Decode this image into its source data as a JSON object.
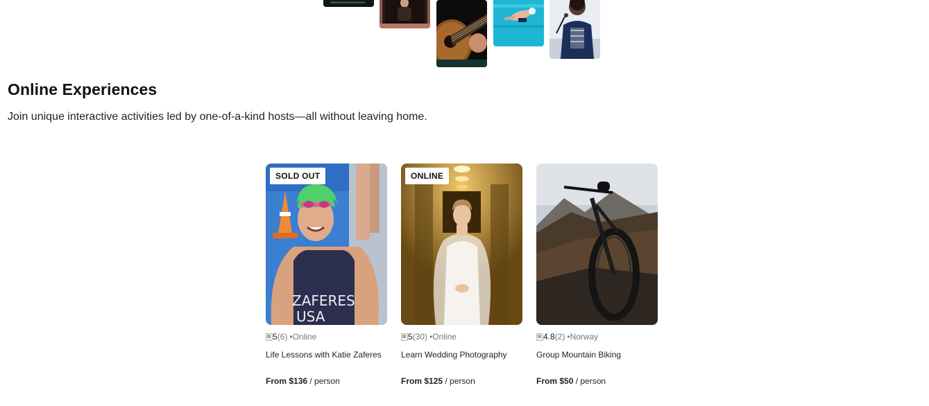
{
  "top_strip": [
    {
      "subject": "dark-landscape"
    },
    {
      "subject": "person-on-stairs"
    },
    {
      "subject": "acoustic-guitar"
    },
    {
      "subject": "swimmer-in-pool"
    },
    {
      "subject": "singer-with-microphone"
    }
  ],
  "section": {
    "title": "Online Experiences",
    "subtitle": "Join unique interactive activities led by one-of-a-kind hosts—all without leaving home."
  },
  "cards": [
    {
      "badge": "SOLD OUT",
      "rating": "5",
      "reviews": "(6)",
      "separator": "•",
      "location": "Online",
      "title": "Life Lessons with Katie Zaferes",
      "price_prefix": "From ",
      "price": "$136",
      "price_suffix": " / person",
      "photo_text_1": "ZAFERES",
      "photo_text_2": "USA"
    },
    {
      "badge": "ONLINE",
      "rating": "5",
      "reviews": "(30)",
      "separator": "•",
      "location": "Online",
      "title": "Learn Wedding Photography",
      "price_prefix": "From ",
      "price": "$125",
      "price_suffix": " / person"
    },
    {
      "badge": "",
      "rating": "4.8",
      "reviews": "(2)",
      "separator": "•",
      "location": "Norway",
      "title": "Group Mountain Biking",
      "price_prefix": "From ",
      "price": "$50",
      "price_suffix": " / person"
    }
  ],
  "colors": {
    "text": "#222222",
    "muted": "#767676",
    "badge_bg": "#ffffff",
    "pool_blue": "#1fb6d6"
  },
  "icons": {
    "rating": "star-icon"
  }
}
